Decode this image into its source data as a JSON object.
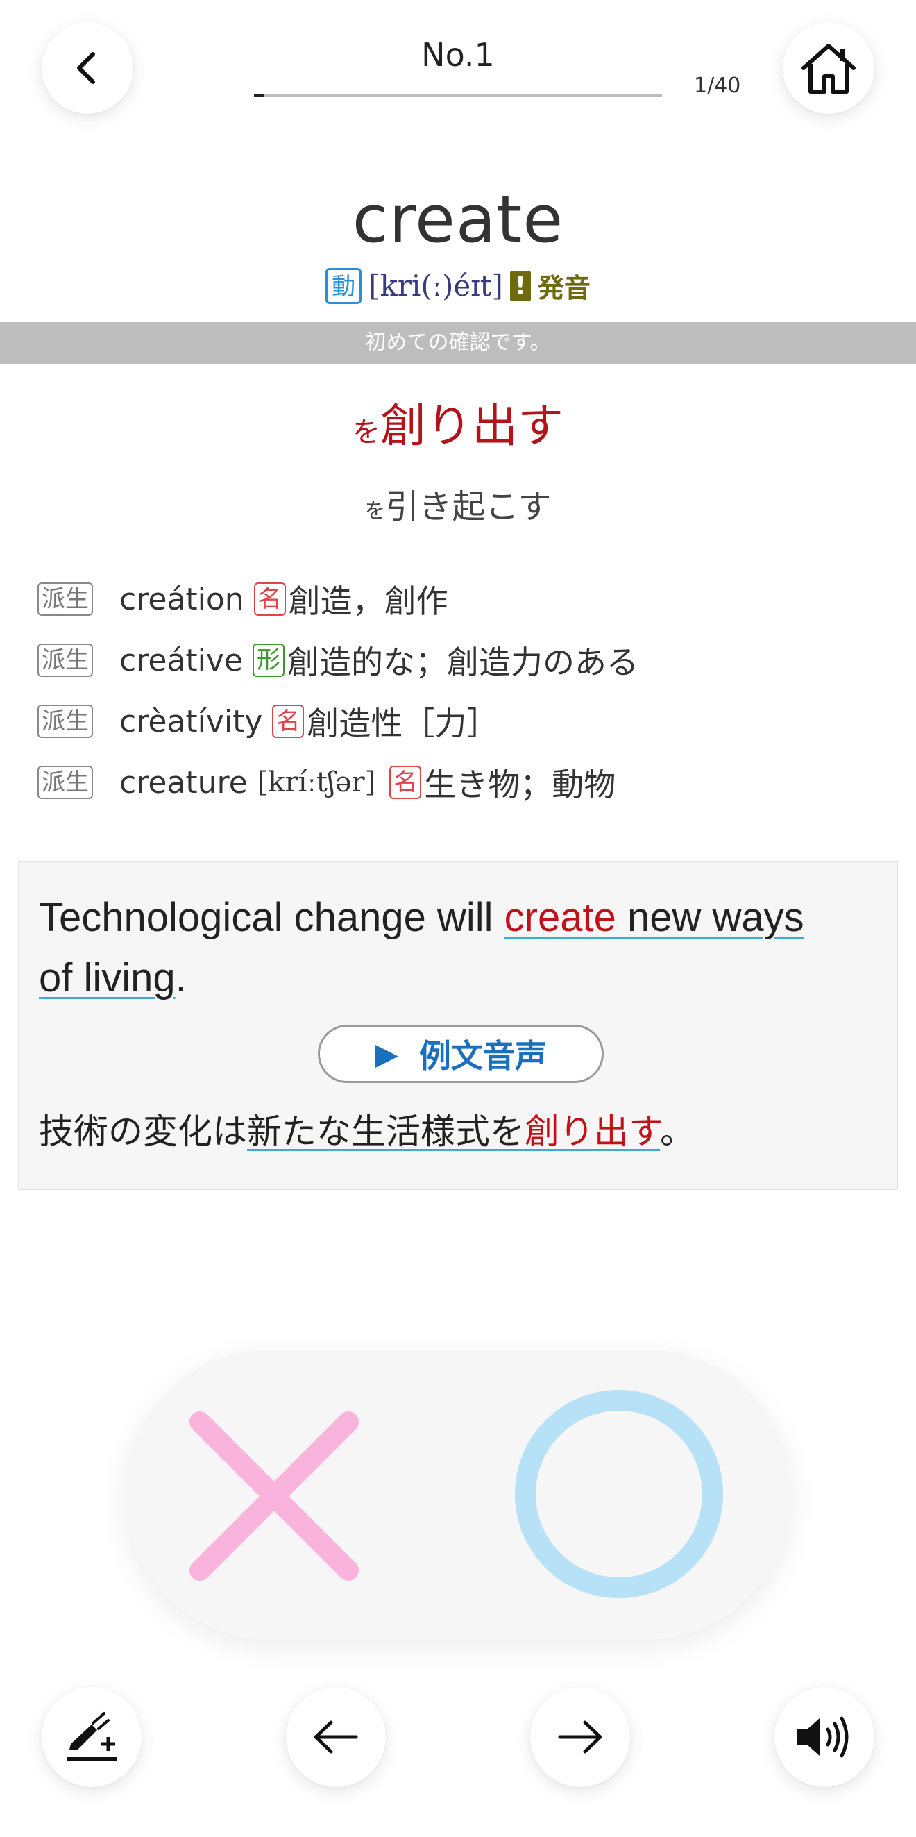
{
  "header": {
    "title": "No.1",
    "progress_label": "1/40",
    "progress_fraction": 0.025
  },
  "word": {
    "headword": "create",
    "pos": "動",
    "ipa": "[kri(ː)éɪt]",
    "warning_mark": "!",
    "warning_label": "発音"
  },
  "status": {
    "message": "初めての確認です。"
  },
  "meanings": {
    "main_particle": "を",
    "main_text": "創り出す",
    "sub_particle": "を",
    "sub_text": "引き起こす"
  },
  "derivatives": [
    {
      "tag": "派生",
      "word": "creátion",
      "ipa": "",
      "pos": "名",
      "pos_color": "#e0444a",
      "meaning": "創造，創作"
    },
    {
      "tag": "派生",
      "word": "creátive",
      "ipa": "",
      "pos": "形",
      "pos_color": "#3b9a2a",
      "meaning": "創造的な；創造力のある"
    },
    {
      "tag": "派生",
      "word": "crèatívity",
      "ipa": "",
      "pos": "名",
      "pos_color": "#e0444a",
      "meaning": "創造性［力］"
    },
    {
      "tag": "派生",
      "word": "creature",
      "ipa": "[kríːtʃər]",
      "pos": "名",
      "pos_color": "#e0444a",
      "meaning": "生き物；動物"
    }
  ],
  "example": {
    "en_part1": "Technological change will ",
    "en_highlight": "create",
    "en_part2": " new ways",
    "en_part3": "of living",
    "en_end": ".",
    "audio_label": "例文音声",
    "ja_part1": "技術の変化は",
    "ja_underlined": "新たな生活様式を",
    "ja_highlight": "創り出す",
    "ja_end": "。"
  },
  "icons": {
    "back": "chevron-left-icon",
    "home": "home-icon",
    "incorrect": "cross-icon",
    "correct": "circle-icon",
    "note": "highlighter-plus-icon",
    "prev": "arrow-left-icon",
    "next": "arrow-right-icon",
    "sound": "speaker-icon"
  },
  "colors": {
    "accent_red": "#c0121b",
    "cross_pink": "#f9b3dc",
    "circle_blue": "#b6e1f7",
    "link_blue": "#1a6fbf"
  }
}
